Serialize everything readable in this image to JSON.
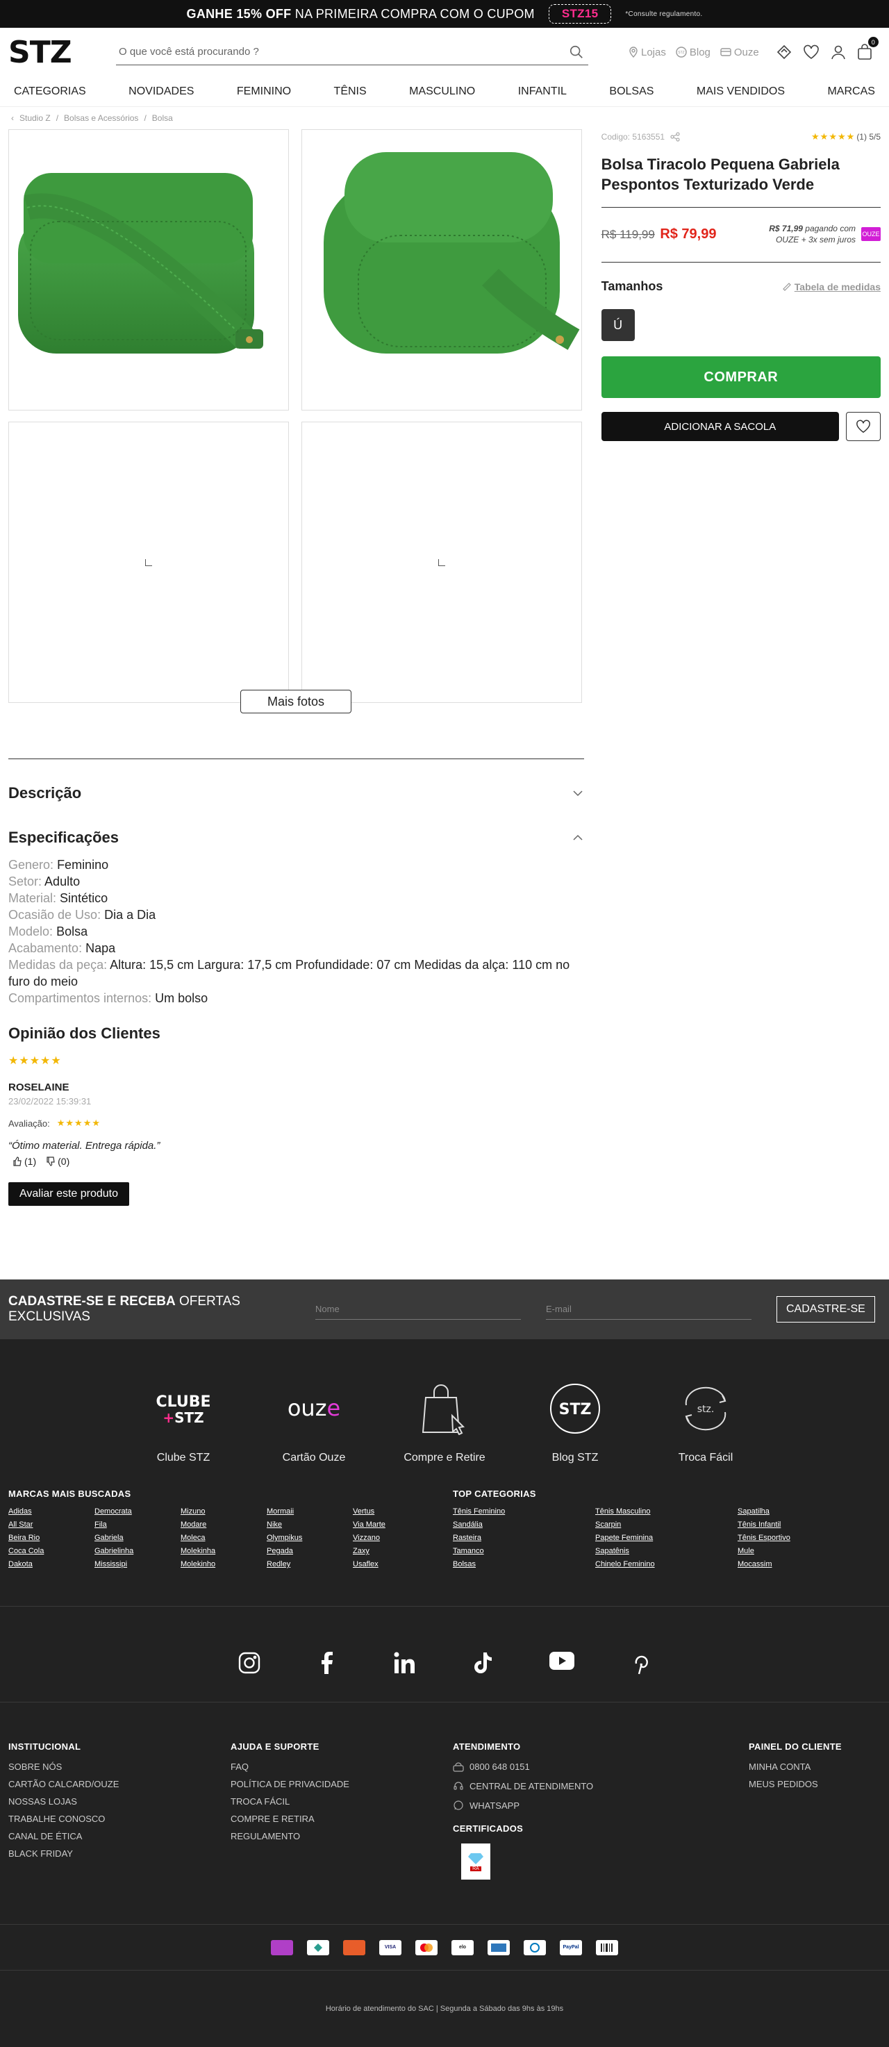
{
  "promo": {
    "text_bold": "GANHE 15% OFF",
    "text": "NA PRIMEIRA COMPRA COM O CUPOM",
    "code": "STZ15",
    "note": "*Consulte regulamento."
  },
  "header": {
    "logo": "STZ",
    "search_placeholder": "O que você está procurando ?",
    "links": [
      "Lojas",
      "Blog",
      "Ouze"
    ],
    "cart_count": "0"
  },
  "nav": [
    "CATEGORIAS",
    "NOVIDADES",
    "FEMININO",
    "TÊNIS",
    "MASCULINO",
    "INFANTIL",
    "BOLSAS",
    "MAIS VENDIDOS",
    "MARCAS"
  ],
  "breadcrumb": [
    "Studio Z",
    "Bolsas e Acessórios",
    "Bolsa"
  ],
  "product": {
    "code": "Codigo: 5163551",
    "rating_count": "(1) 5/5",
    "rating": 5,
    "title": "Bolsa Tiracolo Pequena Gabriela Pespontos Texturizado Verde",
    "price_old": "R$ 119,99",
    "price_new": "R$ 79,99",
    "ouze_price": "R$ 71,99",
    "ouze_line1": "pagando com",
    "ouze_line2": "OUZE + 3x sem juros",
    "ouze_badge": "OUZE",
    "sizes_label": "Tamanhos",
    "measure_label": "Tabela de medidas",
    "size_value": "Ú",
    "buy_label": "COMPRAR",
    "bag_label": "ADICIONAR A SACOLA",
    "more_photos": "Mais fotos",
    "color": "#3d9a3d"
  },
  "description": {
    "desc_title": "Descrição",
    "spec_title": "Especificações",
    "specs": [
      {
        "k": "Genero:",
        "v": "Feminino"
      },
      {
        "k": "Setor:",
        "v": "Adulto"
      },
      {
        "k": "Material:",
        "v": "Sintético"
      },
      {
        "k": "Ocasião de Uso:",
        "v": "Dia a Dia"
      },
      {
        "k": "Modelo:",
        "v": "Bolsa"
      },
      {
        "k": "Acabamento:",
        "v": "Napa"
      },
      {
        "k": "Medidas da peça:",
        "v": "Altura: 15,5 cm Largura: 17,5 cm Profundidade: 07 cm Medidas da alça: 110 cm no furo do meio"
      },
      {
        "k": "Compartimentos internos:",
        "v": "Um bolso"
      }
    ]
  },
  "reviews": {
    "title": "Opinião dos Clientes",
    "author": "ROSELAINE",
    "date": "23/02/2022 15:39:31",
    "rating_label": "Avaliação:",
    "text": "“Ótimo material. Entrega rápida.”",
    "likes": "(1)",
    "dislikes": "(0)",
    "button": "Avaliar este produto"
  },
  "newsletter": {
    "bold": "CADASTRE-SE E RECEBA",
    "text": "OFERTAS EXCLUSIVAS",
    "name_ph": "Nome",
    "email_ph": "E-mail",
    "button": "CADASTRE-SE"
  },
  "services": [
    "Clube STZ",
    "Cartão Ouze",
    "Compre e Retire",
    "Blog STZ",
    "Troca Fácil"
  ],
  "brands": {
    "title": "MARCAS MAIS BUSCADAS",
    "items": [
      "Adidas",
      "Democrata",
      "Mizuno",
      "Mormaii",
      "Vertus",
      "All Star",
      "Fila",
      "Modare",
      "Nike",
      "Via Marte",
      "Beira Rio",
      "Gabriela",
      "Moleca",
      "Olympikus",
      "Vizzano",
      "Coca Cola",
      "Gabrielinha",
      "Molekinha",
      "Pegada",
      "Zaxy",
      "Dakota",
      "Mississipi",
      "Molekinho",
      "Redley",
      "Usaflex"
    ]
  },
  "categories": {
    "title": "TOP CATEGORIAS",
    "items": [
      "Tênis Feminino",
      "Tênis Masculino",
      "Sapatilha",
      "Sandália",
      "Scarpin",
      "Tênis Infantil",
      "Rasteira",
      "Papete Feminina",
      "Tênis Esportivo",
      "Tamanco",
      "Sapatênis",
      "Mule",
      "Bolsas",
      "Chinelo Feminino",
      "Mocassim"
    ]
  },
  "footer": {
    "inst_title": "INSTITUCIONAL",
    "inst": [
      "SOBRE NÓS",
      "CARTÃO CALCARD/OUZE",
      "NOSSAS LOJAS",
      "TRABALHE CONOSCO",
      "CANAL DE ÉTICA",
      "BLACK FRIDAY"
    ],
    "help_title": "AJUDA E SUPORTE",
    "help": [
      "FAQ",
      "POLÍTICA DE PRIVACIDADE",
      "TROCA FÁCIL",
      "COMPRE E RETIRA",
      "REGULAMENTO"
    ],
    "atd_title": "ATENDIMENTO",
    "atd": [
      "0800 648 0151",
      "CENTRAL DE ATENDIMENTO",
      "WHATSAPP"
    ],
    "cert_title": "CERTIFICADOS",
    "panel_title": "PAINEL DO CLIENTE",
    "panel": [
      "MINHA CONTA",
      "MEUS PEDIDOS"
    ],
    "sac": "Horário de atendimento do SAC | Segunda a Sábado das 9hs às 19hs"
  }
}
